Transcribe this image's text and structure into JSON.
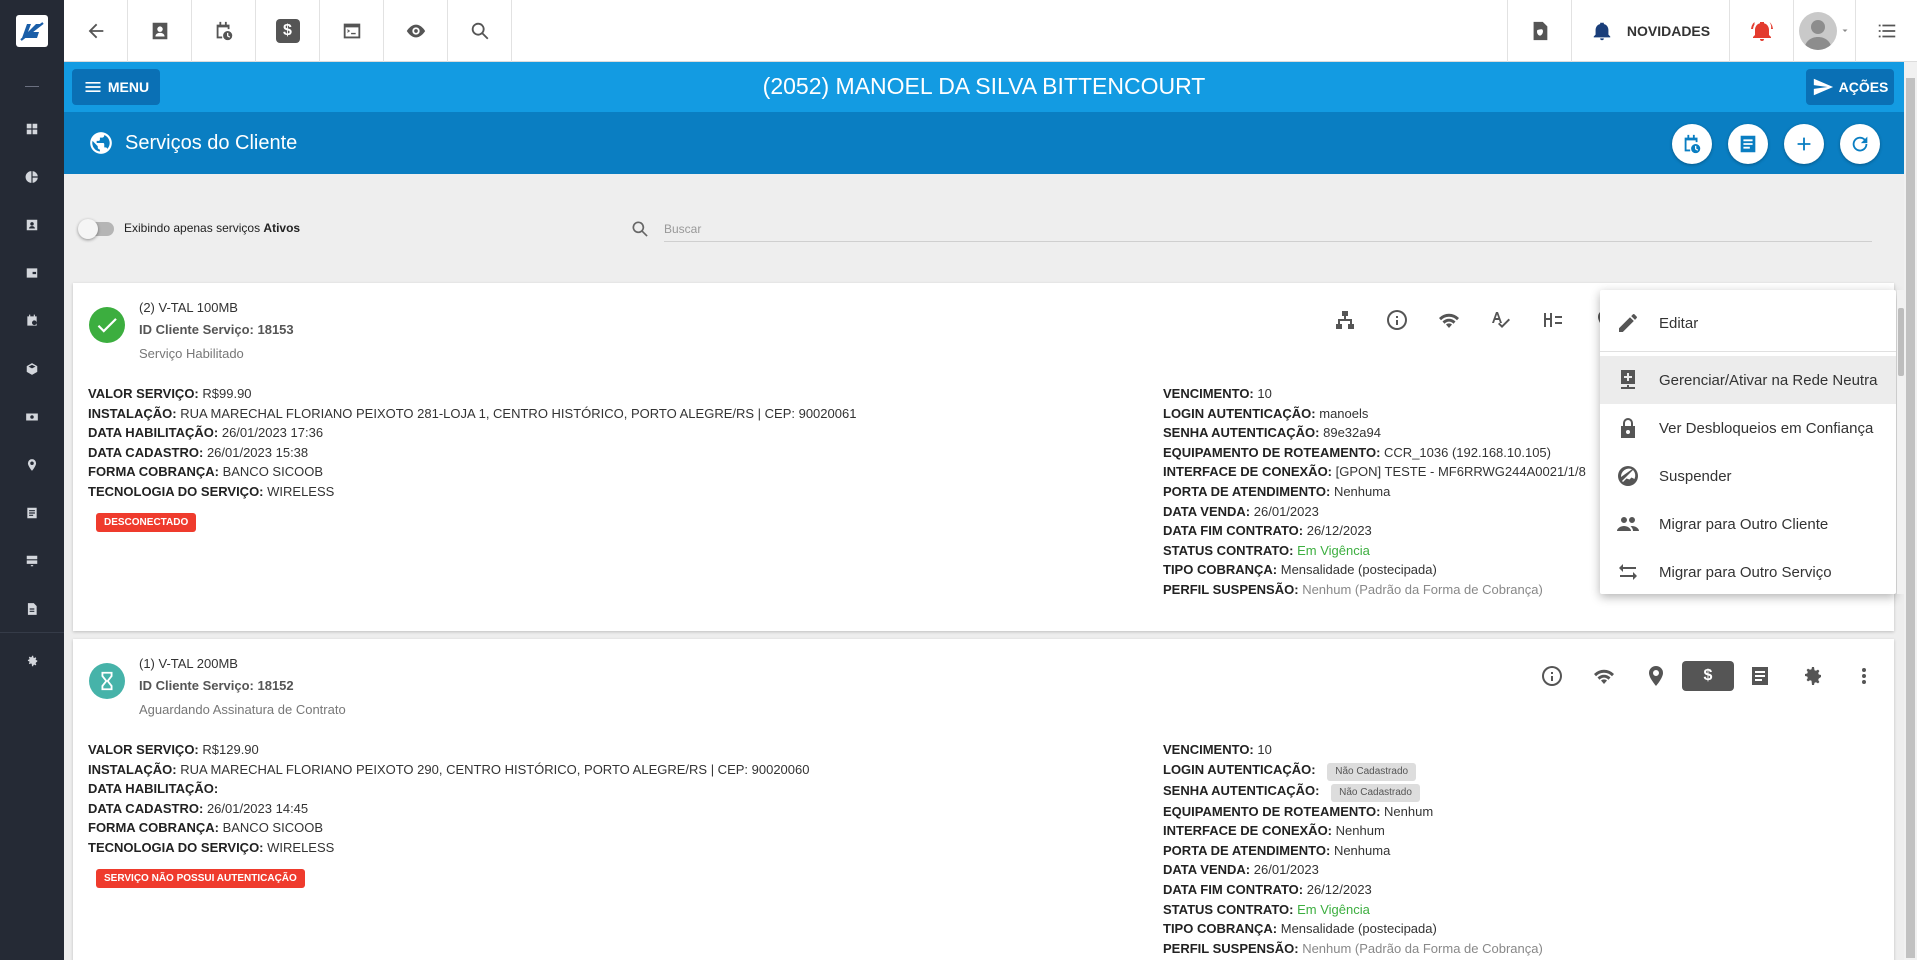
{
  "topbar": {
    "novidades_label": "NOVIDADES"
  },
  "titlebar": {
    "menu_label": "MENU",
    "client_name": "(2052) MANOEL DA SILVA BITTENCOURT",
    "acoes_label": "AÇÕES"
  },
  "section": {
    "title": "Serviços do Cliente"
  },
  "filter": {
    "label_prefix": "Exibindo apenas serviços ",
    "label_bold": "Ativos",
    "search_placeholder": "Buscar",
    "search_value": ""
  },
  "services": [
    {
      "title": "(2) V-TAL 100MB",
      "id_text": "ID Cliente Serviço: 18153",
      "status_text": "Serviço Habilitado",
      "status_color": "#3cae3f",
      "badge": "DESCONECTADO",
      "left": [
        {
          "label": "VALOR SERVIÇO:",
          "value": "R$99.90"
        },
        {
          "label": "INSTALAÇÃO:",
          "value": "RUA MARECHAL FLORIANO PEIXOTO 281-LOJA 1, CENTRO HISTÓRICO, PORTO ALEGRE/RS | CEP: 90020061"
        },
        {
          "label": "DATA HABILITAÇÃO:",
          "value": "26/01/2023 17:36"
        },
        {
          "label": "DATA CADASTRO:",
          "value": "26/01/2023 15:38"
        },
        {
          "label": "FORMA COBRANÇA:",
          "value": "BANCO SICOOB"
        },
        {
          "label": "TECNOLOGIA DO SERVIÇO:",
          "value": "WIRELESS"
        }
      ],
      "right": [
        {
          "label": "VENCIMENTO:",
          "value": "10"
        },
        {
          "label": "LOGIN AUTENTICAÇÃO:",
          "value": "manoels"
        },
        {
          "label": "SENHA AUTENTICAÇÃO:",
          "value": "89e32a94"
        },
        {
          "label": "EQUIPAMENTO DE ROTEAMENTO:",
          "value": "CCR_1036 (192.168.10.105)"
        },
        {
          "label": "INTERFACE DE CONEXÃO:",
          "value": "[GPON] TESTE - MF6RRWG244A0021/1/8"
        },
        {
          "label": "PORTA DE ATENDIMENTO:",
          "value": "Nenhuma"
        },
        {
          "label": "DATA VENDA:",
          "value": "26/01/2023"
        },
        {
          "label": "DATA FIM CONTRATO:",
          "value": "26/12/2023"
        },
        {
          "label": "STATUS CONTRATO:",
          "value": "Em Vigência"
        },
        {
          "label": "TIPO COBRANÇA:",
          "value": "Mensalidade (postecipada)"
        },
        {
          "label": "PERFIL SUSPENSÃO:",
          "value": "Nenhum (Padrão da Forma de Cobrança)"
        }
      ]
    },
    {
      "title": "(1) V-TAL 200MB",
      "id_text": "ID Cliente Serviço: 18152",
      "status_text": "Aguardando Assinatura de Contrato",
      "status_color": "#46b3a9",
      "badge": "SERVIÇO NÃO POSSUI AUTENTICAÇÃO",
      "left": [
        {
          "label": "VALOR SERVIÇO:",
          "value": "R$129.90"
        },
        {
          "label": "INSTALAÇÃO:",
          "value": "RUA MARECHAL FLORIANO PEIXOTO 290, CENTRO HISTÓRICO, PORTO ALEGRE/RS | CEP: 90020060"
        },
        {
          "label": "DATA HABILITAÇÃO:",
          "value": ""
        },
        {
          "label": "DATA CADASTRO:",
          "value": "26/01/2023 14:45"
        },
        {
          "label": "FORMA COBRANÇA:",
          "value": "BANCO SICOOB"
        },
        {
          "label": "TECNOLOGIA DO SERVIÇO:",
          "value": "WIRELESS"
        }
      ],
      "right": [
        {
          "label": "VENCIMENTO:",
          "value": "10"
        },
        {
          "label": "LOGIN AUTENTICAÇÃO:",
          "value": "Não Cadastrado"
        },
        {
          "label": "SENHA AUTENTICAÇÃO:",
          "value": "Não Cadastrado"
        },
        {
          "label": "EQUIPAMENTO DE ROTEAMENTO:",
          "value": "Nenhum"
        },
        {
          "label": "INTERFACE DE CONEXÃO:",
          "value": "Nenhum"
        },
        {
          "label": "PORTA DE ATENDIMENTO:",
          "value": "Nenhuma"
        },
        {
          "label": "DATA VENDA:",
          "value": "26/01/2023"
        },
        {
          "label": "DATA FIM CONTRATO:",
          "value": "26/12/2023"
        },
        {
          "label": "STATUS CONTRATO:",
          "value": "Em Vigência"
        },
        {
          "label": "TIPO COBRANÇA:",
          "value": "Mensalidade (postecipada)"
        },
        {
          "label": "PERFIL SUSPENSÃO:",
          "value": "Nenhum (Padrão da Forma de Cobrança)"
        }
      ]
    }
  ],
  "dropdown": {
    "items": [
      {
        "label": "Editar",
        "icon": "pencil-icon"
      },
      {
        "label": "Gerenciar/Ativar na Rede Neutra",
        "icon": "add-network-icon"
      },
      {
        "label": "Ver Desbloqueios em Confiança",
        "icon": "lock-icon"
      },
      {
        "label": "Suspender",
        "icon": "suspend-icon"
      },
      {
        "label": "Migrar para Outro Cliente",
        "icon": "people-icon"
      },
      {
        "label": "Migrar para Outro Serviço",
        "icon": "swap-icon"
      }
    ]
  },
  "colors": {
    "accent_blue": "#139be2",
    "section_blue": "#0a7ec2",
    "sidebar": "#252a35",
    "badge_red": "#ef3b2d",
    "contract_green": "#3cae3f"
  }
}
